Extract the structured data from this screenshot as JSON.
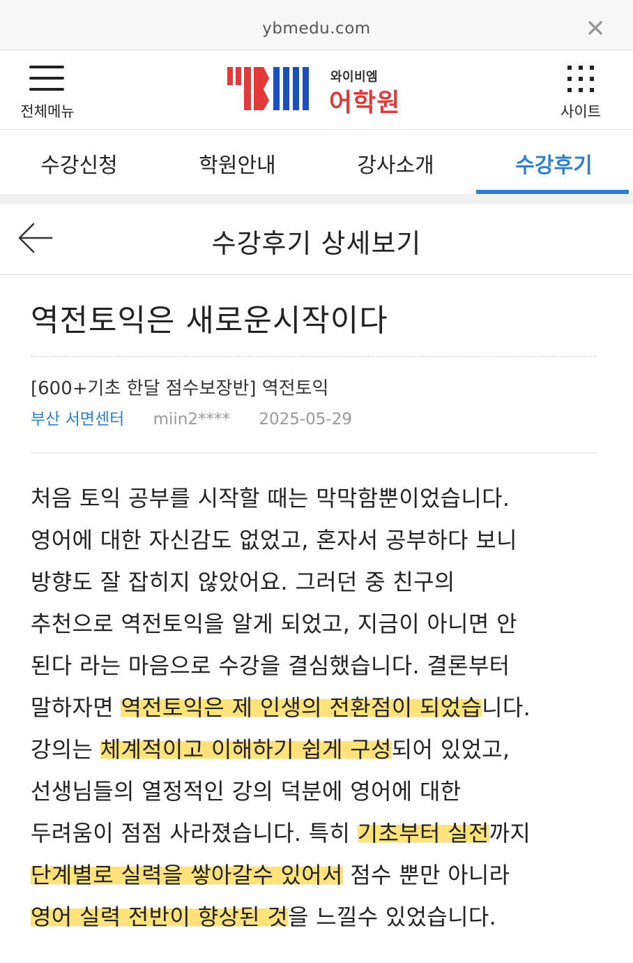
{
  "browser": {
    "url": "ybmedu.com",
    "close_icon": "close-icon"
  },
  "header": {
    "menu_label": "전체메뉴",
    "menu_icon": "hamburger-icon",
    "logo_sub": "와이비엠",
    "logo_main": "어학원",
    "site_label": "사이트",
    "site_icon": "grid-dots-icon",
    "brand_red": "#e03a3a",
    "brand_blue": "#1f4fb8"
  },
  "tabs": [
    {
      "label": "수강신청",
      "active": false
    },
    {
      "label": "학원안내",
      "active": false
    },
    {
      "label": "강사소개",
      "active": false
    },
    {
      "label": "수강후기",
      "active": true
    }
  ],
  "accent_color": "#2f7fd0",
  "page": {
    "back_icon": "arrow-left-icon",
    "title": "수강후기 상세보기"
  },
  "post": {
    "title": "역전토익은 새로운시작이다",
    "course": "[600+기초 한달 점수보장반] 역전토익",
    "center": "부산 서면센터",
    "user": "miin2****",
    "date": "2025-05-29",
    "lines": [
      [
        {
          "t": "처음 토익 공부를 시작할 때는 막막함뿐이었습니다.",
          "h": false
        }
      ],
      [
        {
          "t": "영어에 대한 자신감도 없었고, 혼자서 공부하다 보니",
          "h": false
        }
      ],
      [
        {
          "t": "방향도 잘 잡히지 않았어요. 그러던 중 친구의",
          "h": false
        }
      ],
      [
        {
          "t": "추천으로 역전토익을 알게 되었고, 지금이 아니면 안",
          "h": false
        }
      ],
      [
        {
          "t": "된다 라는 마음으로 수강을 결심했습니다. 결론부터",
          "h": false
        }
      ],
      [
        {
          "t": "말하자면 ",
          "h": false
        },
        {
          "t": "역전토익은 제 인생의 전환점이 되었습",
          "h": true
        },
        {
          "t": "니다.",
          "h": false
        }
      ],
      [
        {
          "t": "강의는 ",
          "h": false
        },
        {
          "t": "체계적이고 이해하기 쉽게 구성",
          "h": true
        },
        {
          "t": "되어 있었고,",
          "h": false
        }
      ],
      [
        {
          "t": "선생님들의 열정적인 강의 덕분에 영어에 대한",
          "h": false
        }
      ],
      [
        {
          "t": "두려움이 점점 사라졌습니다. 특히 ",
          "h": false
        },
        {
          "t": "기초부터 실전",
          "h": true
        },
        {
          "t": "까지",
          "h": false
        }
      ],
      [
        {
          "t": "단계별로 실력을 쌓아갈수 있어서",
          "h": true
        },
        {
          "t": " 점수 뿐만 아니라",
          "h": false
        }
      ],
      [
        {
          "t": "영어 실력 전반이 향상된 것",
          "h": true
        },
        {
          "t": "을 느낄수 있었습니다.",
          "h": false
        }
      ]
    ]
  }
}
